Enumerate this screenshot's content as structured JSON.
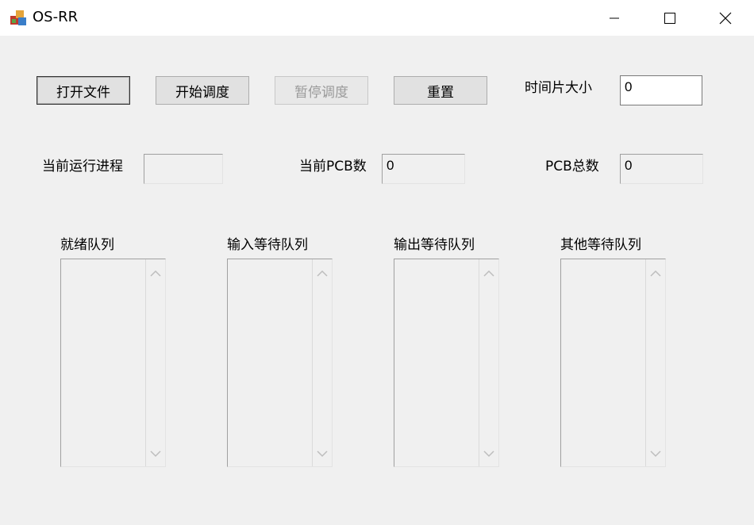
{
  "window": {
    "title": "OS-RR"
  },
  "buttons": {
    "open_file": "打开文件",
    "start": "开始调度",
    "pause": "暂停调度",
    "reset": "重置"
  },
  "time_slice": {
    "label": "时间片大小",
    "value": "0"
  },
  "current_process": {
    "label": "当前运行进程",
    "value": ""
  },
  "current_pcb": {
    "label": "当前PCB数",
    "value": "0"
  },
  "total_pcb": {
    "label": "PCB总数",
    "value": "0"
  },
  "queues": {
    "ready": "就绪队列",
    "input_wait": "输入等待队列",
    "output_wait": "输出等待队列",
    "other_wait": "其他等待队列"
  }
}
